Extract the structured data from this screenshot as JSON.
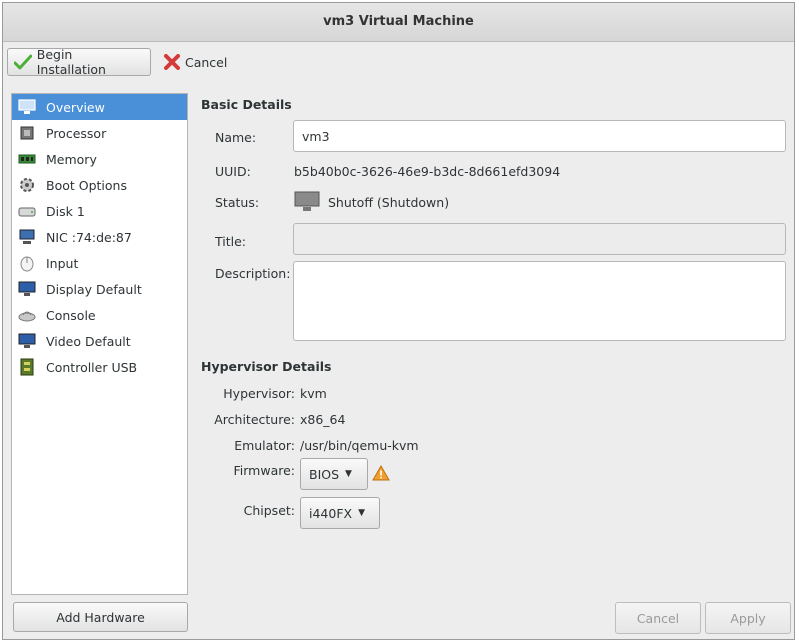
{
  "window": {
    "title": "vm3 Virtual Machine"
  },
  "toolbar": {
    "begin_label": "Begin Installation",
    "cancel_label": "Cancel"
  },
  "sidebar": {
    "items": [
      {
        "label": "Overview",
        "icon": "monitor-icon",
        "selected": true
      },
      {
        "label": "Processor",
        "icon": "processor-icon"
      },
      {
        "label": "Memory",
        "icon": "memory-icon"
      },
      {
        "label": "Boot Options",
        "icon": "boot-options-icon"
      },
      {
        "label": "Disk 1",
        "icon": "disk-icon"
      },
      {
        "label": "NIC :74:de:87",
        "icon": "network-icon"
      },
      {
        "label": "Input",
        "icon": "mouse-icon"
      },
      {
        "label": "Display Default",
        "icon": "display-icon"
      },
      {
        "label": "Console",
        "icon": "console-icon"
      },
      {
        "label": "Video Default",
        "icon": "video-icon"
      },
      {
        "label": "Controller USB",
        "icon": "usb-controller-icon"
      }
    ],
    "add_hardware_label": "Add Hardware"
  },
  "basic": {
    "title": "Basic Details",
    "name_label": "Name:",
    "name_value": "vm3",
    "uuid_label": "UUID:",
    "uuid_value": "b5b40b0c-3626-46e9-b3dc-8d661efd3094",
    "status_label": "Status:",
    "status_value": "Shutoff (Shutdown)",
    "title_label": "Title:",
    "title_value": "",
    "description_label": "Description:",
    "description_value": ""
  },
  "hypervisor": {
    "title": "Hypervisor Details",
    "hypervisor_label": "Hypervisor:",
    "hypervisor_value": "kvm",
    "architecture_label": "Architecture:",
    "architecture_value": "x86_64",
    "emulator_label": "Emulator:",
    "emulator_value": "/usr/bin/qemu-kvm",
    "firmware_label": "Firmware:",
    "firmware_value": "BIOS",
    "chipset_label": "Chipset:",
    "chipset_value": "i440FX"
  },
  "buttons": {
    "cancel_label": "Cancel",
    "apply_label": "Apply"
  },
  "colors": {
    "selection": "#4a90d9",
    "warning": "#f0a030",
    "cancel_icon": "#d43a3a",
    "check_icon": "#4caf3a"
  }
}
